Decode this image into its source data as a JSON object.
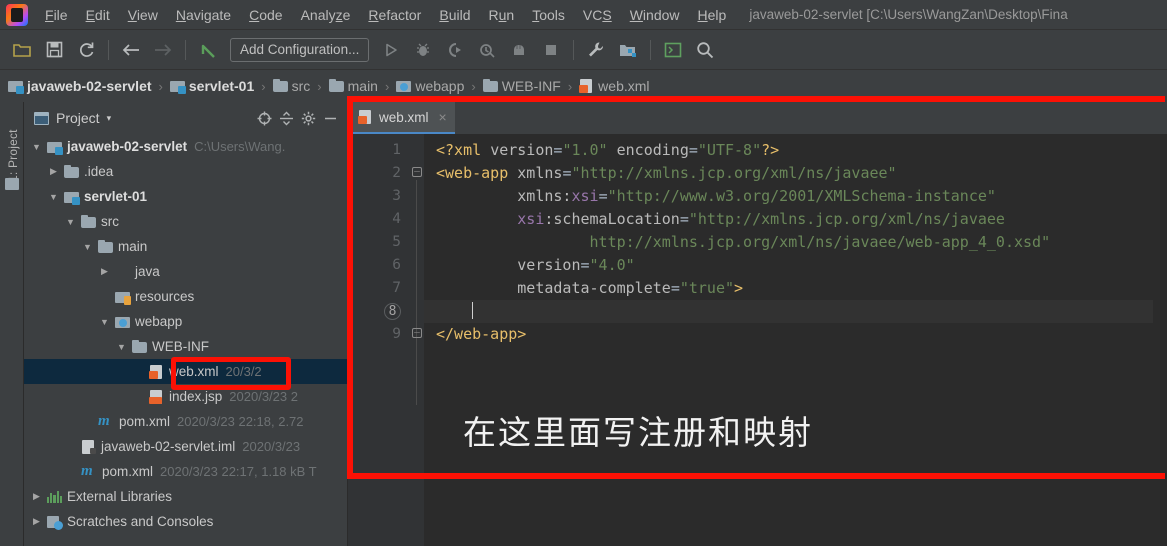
{
  "window": {
    "title": "javaweb-02-servlet [C:\\Users\\WangZan\\Desktop\\Fina",
    "accent_blue": "#4a88c7",
    "annotation_red": "#fc1105",
    "bg_panel": "#3c3f41",
    "bg_editor": "#2b2b2b"
  },
  "menubar": {
    "items": [
      {
        "label": "File",
        "mnemonic": "F"
      },
      {
        "label": "Edit",
        "mnemonic": "E"
      },
      {
        "label": "View",
        "mnemonic": "V"
      },
      {
        "label": "Navigate",
        "mnemonic": "N"
      },
      {
        "label": "Code",
        "mnemonic": "C"
      },
      {
        "label": "Analyze",
        "mnemonic": "z"
      },
      {
        "label": "Refactor",
        "mnemonic": "R"
      },
      {
        "label": "Build",
        "mnemonic": "B"
      },
      {
        "label": "Run",
        "mnemonic": "u"
      },
      {
        "label": "Tools",
        "mnemonic": "T"
      },
      {
        "label": "VCS",
        "mnemonic": "S"
      },
      {
        "label": "Window",
        "mnemonic": "W"
      },
      {
        "label": "Help",
        "mnemonic": "H"
      }
    ]
  },
  "toolbar": {
    "icons": [
      "open-folder-icon",
      "save-all-icon",
      "sync-icon",
      "back-arrow-icon",
      "forward-arrow-icon",
      "undo-icon"
    ],
    "run_config_label": "Add Configuration...",
    "run_icons": [
      "run-icon",
      "debug-icon",
      "run-coverage-icon",
      "profile-icon",
      "build-icon",
      "stop-icon"
    ],
    "right_icons": [
      "settings-wrench-icon",
      "project-structure-icon",
      "terminal-icon",
      "search-everywhere-icon"
    ]
  },
  "breadcrumb": {
    "items": [
      {
        "label": "javaweb-02-servlet",
        "icon": "module-icon",
        "style": "bold"
      },
      {
        "label": "servlet-01",
        "icon": "module-icon",
        "style": "bold"
      },
      {
        "label": "src",
        "icon": "folder-icon",
        "style": "dim"
      },
      {
        "label": "main",
        "icon": "folder-icon",
        "style": "dim"
      },
      {
        "label": "webapp",
        "icon": "webapp-folder-icon",
        "style": "dim"
      },
      {
        "label": "WEB-INF",
        "icon": "folder-icon",
        "style": "dim"
      },
      {
        "label": "web.xml",
        "icon": "xml-file-icon",
        "style": "dim"
      }
    ],
    "separator": "›"
  },
  "tool_strip": {
    "label": "1: Project",
    "icon": "project-folder-icon"
  },
  "project_panel": {
    "title": "Project",
    "dropdown_caret": "▾",
    "header_icons": [
      "locate-icon",
      "collapse-all-icon",
      "settings-gear-icon",
      "hide-icon"
    ],
    "tree": [
      {
        "label": "javaweb-02-servlet",
        "meta": "C:\\Users\\Wang.",
        "icon": "module-icon",
        "indent": 0,
        "arrow": "down",
        "bold": true,
        "selected": false
      },
      {
        "label": ".idea",
        "meta": "",
        "icon": "folder-icon",
        "indent": 1,
        "arrow": "right",
        "bold": false,
        "selected": false
      },
      {
        "label": "servlet-01",
        "meta": "",
        "icon": "module-icon",
        "indent": 1,
        "arrow": "down",
        "bold": true,
        "selected": false
      },
      {
        "label": "src",
        "meta": "",
        "icon": "folder-icon",
        "indent": 2,
        "arrow": "down",
        "bold": false,
        "selected": false
      },
      {
        "label": "main",
        "meta": "",
        "icon": "folder-icon",
        "indent": 3,
        "arrow": "down",
        "bold": false,
        "selected": false
      },
      {
        "label": "java",
        "meta": "",
        "icon": "source-folder-icon",
        "indent": 4,
        "arrow": "right",
        "bold": false,
        "selected": false
      },
      {
        "label": "resources",
        "meta": "",
        "icon": "resources-folder-icon",
        "indent": 4,
        "arrow": "none",
        "bold": false,
        "selected": false
      },
      {
        "label": "webapp",
        "meta": "",
        "icon": "webapp-folder-icon",
        "indent": 4,
        "arrow": "down",
        "bold": false,
        "selected": false
      },
      {
        "label": "WEB-INF",
        "meta": "",
        "icon": "folder-icon",
        "indent": 5,
        "arrow": "down",
        "bold": false,
        "selected": false
      },
      {
        "label": "web.xml",
        "meta": "20/3/2",
        "icon": "xml-file-icon",
        "indent": 6,
        "arrow": "none",
        "bold": false,
        "selected": true
      },
      {
        "label": "index.jsp",
        "meta": "2020/3/23 2",
        "icon": "jsp-file-icon",
        "indent": 6,
        "arrow": "none",
        "bold": false,
        "selected": false
      },
      {
        "label": "pom.xml",
        "meta": "2020/3/23 22:18, 2.72",
        "icon": "maven-icon",
        "indent": 3,
        "arrow": "none",
        "bold": false,
        "selected": false
      },
      {
        "label": "javaweb-02-servlet.iml",
        "meta": "2020/3/23",
        "icon": "iml-file-icon",
        "indent": 2,
        "arrow": "none",
        "bold": false,
        "selected": false
      },
      {
        "label": "pom.xml",
        "meta": "2020/3/23 22:17, 1.18 kB T",
        "icon": "maven-icon",
        "indent": 2,
        "arrow": "none",
        "bold": false,
        "selected": false
      },
      {
        "label": "External Libraries",
        "meta": "",
        "icon": "libraries-icon",
        "indent": 0,
        "arrow": "right",
        "bold": false,
        "selected": false
      },
      {
        "label": "Scratches and Consoles",
        "meta": "",
        "icon": "scratches-icon",
        "indent": 0,
        "arrow": "right",
        "bold": false,
        "selected": false
      }
    ]
  },
  "editor": {
    "tab": {
      "label": "web.xml",
      "icon": "xml-file-icon",
      "close": "×"
    },
    "line_numbers": [
      "1",
      "2",
      "3",
      "4",
      "5",
      "6",
      "7",
      "8",
      "9"
    ],
    "current_line": 8,
    "annotation_text": "在这里面写注册和映射",
    "code_lines": [
      {
        "n": 1,
        "segments": [
          {
            "t": "<?xml ",
            "c": "proc"
          },
          {
            "t": "version",
            "c": "attr"
          },
          {
            "t": "=",
            "c": "punct"
          },
          {
            "t": "\"1.0\"",
            "c": "str"
          },
          {
            "t": " ",
            "c": "punct"
          },
          {
            "t": "encoding",
            "c": "attr"
          },
          {
            "t": "=",
            "c": "punct"
          },
          {
            "t": "\"UTF-8\"",
            "c": "str"
          },
          {
            "t": "?>",
            "c": "proc"
          }
        ]
      },
      {
        "n": 2,
        "segments": [
          {
            "t": "<web-app ",
            "c": "tagname"
          },
          {
            "t": "xmlns",
            "c": "attr"
          },
          {
            "t": "=",
            "c": "punct"
          },
          {
            "t": "\"http://xmlns.jcp.org/xml/ns/javaee\"",
            "c": "str"
          }
        ]
      },
      {
        "n": 3,
        "segments": [
          {
            "t": "         ",
            "c": "punct"
          },
          {
            "t": "xmlns:",
            "c": "attr"
          },
          {
            "t": "xsi",
            "c": "attr-ns"
          },
          {
            "t": "=",
            "c": "punct"
          },
          {
            "t": "\"http://www.w3.org/2001/XMLSchema-instance\"",
            "c": "str"
          }
        ]
      },
      {
        "n": 4,
        "segments": [
          {
            "t": "         ",
            "c": "punct"
          },
          {
            "t": "xsi",
            "c": "attr-ns"
          },
          {
            "t": ":schemaLocation",
            "c": "attr"
          },
          {
            "t": "=",
            "c": "punct"
          },
          {
            "t": "\"http://xmlns.jcp.org/xml/ns/javaee",
            "c": "str"
          }
        ]
      },
      {
        "n": 5,
        "segments": [
          {
            "t": "                 ",
            "c": "punct"
          },
          {
            "t": "http://xmlns.jcp.org/xml/ns/javaee/web-app_4_0.xsd\"",
            "c": "str"
          }
        ]
      },
      {
        "n": 6,
        "segments": [
          {
            "t": "         ",
            "c": "punct"
          },
          {
            "t": "version",
            "c": "attr"
          },
          {
            "t": "=",
            "c": "punct"
          },
          {
            "t": "\"4.0\"",
            "c": "str"
          }
        ]
      },
      {
        "n": 7,
        "segments": [
          {
            "t": "         ",
            "c": "punct"
          },
          {
            "t": "metadata-complete",
            "c": "attr"
          },
          {
            "t": "=",
            "c": "punct"
          },
          {
            "t": "\"true\"",
            "c": "str"
          },
          {
            "t": ">",
            "c": "tagname"
          }
        ]
      },
      {
        "n": 8,
        "segments": [
          {
            "t": "    ",
            "c": "punct"
          }
        ]
      },
      {
        "n": 9,
        "segments": [
          {
            "t": "</web-app>",
            "c": "tagname"
          }
        ]
      }
    ]
  }
}
